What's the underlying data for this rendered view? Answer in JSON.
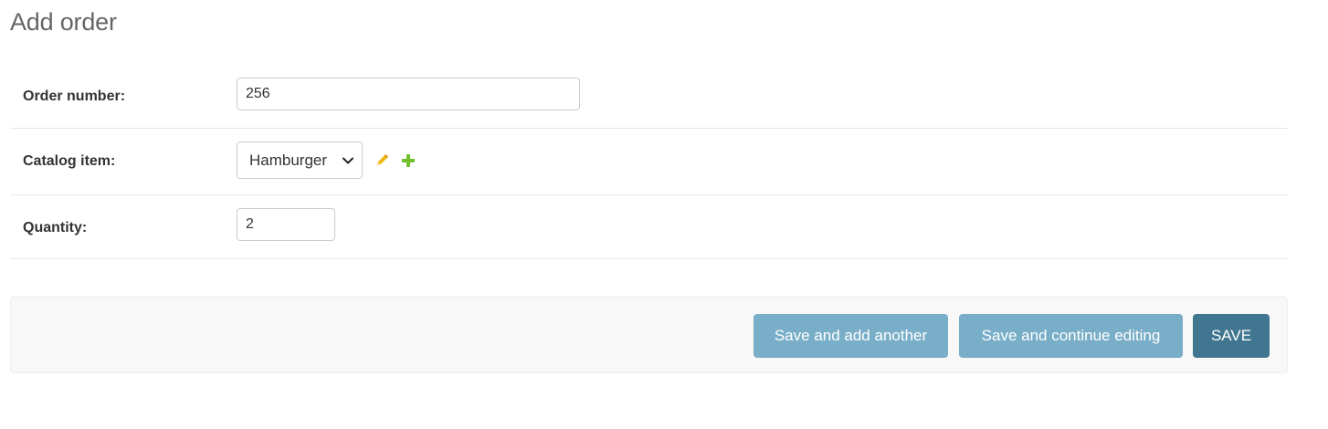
{
  "page": {
    "title": "Add order"
  },
  "form": {
    "order_number": {
      "label": "Order number:",
      "value": "256"
    },
    "catalog_item": {
      "label": "Catalog item:",
      "selected": "Hamburger",
      "edit_icon": "pencil-icon",
      "add_icon": "plus-icon"
    },
    "quantity": {
      "label": "Quantity:",
      "value": "2"
    }
  },
  "actions": {
    "save_add_another": "Save and add another",
    "save_continue": "Save and continue editing",
    "save": "SAVE"
  },
  "colors": {
    "secondary_button": "#79aec8",
    "primary_button": "#417690",
    "edit_icon": "#efb80b",
    "add_icon": "#70bf2b"
  }
}
